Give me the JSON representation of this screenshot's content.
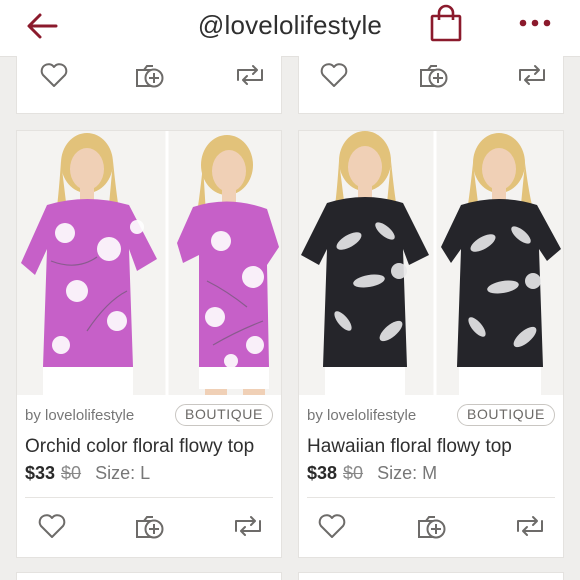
{
  "header": {
    "title": "@lovelolifestyle",
    "icons": {
      "back": "arrow-left-icon",
      "bag": "shopping-bag-icon",
      "more": "more-dots-icon"
    },
    "accent_color": "#8b1a2c"
  },
  "action_icons": [
    "heart-icon",
    "add-to-bundle-icon",
    "share-icon"
  ],
  "listings": [
    {
      "seller": "by lovelolifestyle",
      "badge": "BOUTIQUE",
      "title": "Orchid color floral flowy top",
      "price": "$33",
      "original_price": "$0",
      "size": "Size: L",
      "top_color": "#c660c8"
    },
    {
      "seller": "by lovelolifestyle",
      "badge": "BOUTIQUE",
      "title": "Hawaiian floral flowy top",
      "price": "$38",
      "original_price": "$0",
      "size": "Size: M",
      "top_color": "#25252a"
    }
  ]
}
